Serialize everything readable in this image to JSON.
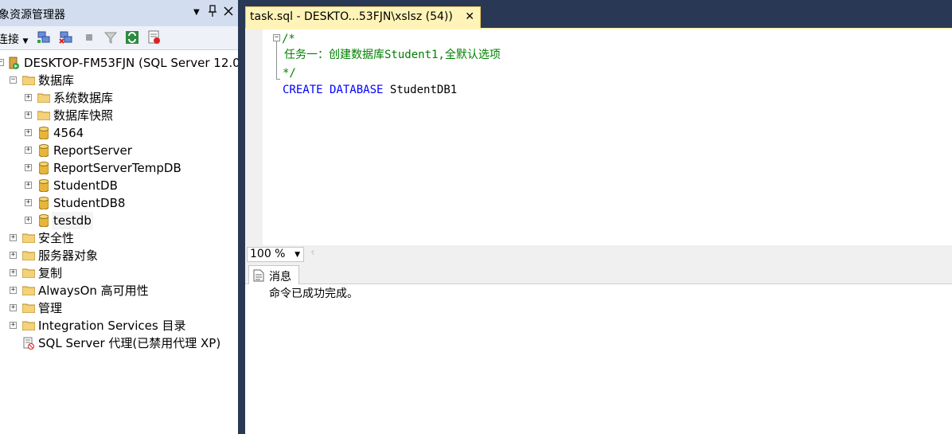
{
  "object_explorer": {
    "title": "象资源管理器",
    "pin_icon": "pin-icon",
    "close_icon": "close-icon",
    "dropdown_icon": "dropdown-icon",
    "toolbar": {
      "connect_label": "连接",
      "icons": [
        "connect-icon",
        "disconnect-icon",
        "stop-icon",
        "filter-icon",
        "refresh-icon",
        "activity-icon"
      ]
    },
    "tree": {
      "server": "DESKTOP-FM53FJN (SQL Server 12.0.",
      "databases_folder": "数据库",
      "databases": {
        "system": "系统数据库",
        "snapshots": "数据库快照",
        "db1": "4564",
        "db2": "ReportServer",
        "db3": "ReportServerTempDB",
        "db4": "StudentDB",
        "db5": "StudentDB8",
        "db6": "testdb"
      },
      "security": "安全性",
      "server_objects": "服务器对象",
      "replication": "复制",
      "alwayson": "AlwaysOn 高可用性",
      "management": "管理",
      "integration": "Integration Services 目录",
      "agent": "SQL Server 代理(已禁用代理 XP)"
    }
  },
  "editor": {
    "tab_title": "task.sql - DESKTO...53FJN\\xslsz (54))",
    "tab_close": "✕",
    "code": {
      "line1": "/*",
      "line2": "任务一：创建数据库Student1,全默认选项",
      "line3": "*/",
      "line4_kw1": "CREATE",
      "line4_kw2": "DATABASE",
      "line4_id": "StudentDB1"
    },
    "zoom": "100 %"
  },
  "results": {
    "tab_label": "消息",
    "message": "命令已成功完成。"
  },
  "colors": {
    "accent_tab": "#fff3b7",
    "comment": "#008000",
    "keyword": "#0000ff",
    "frame": "#293955"
  }
}
